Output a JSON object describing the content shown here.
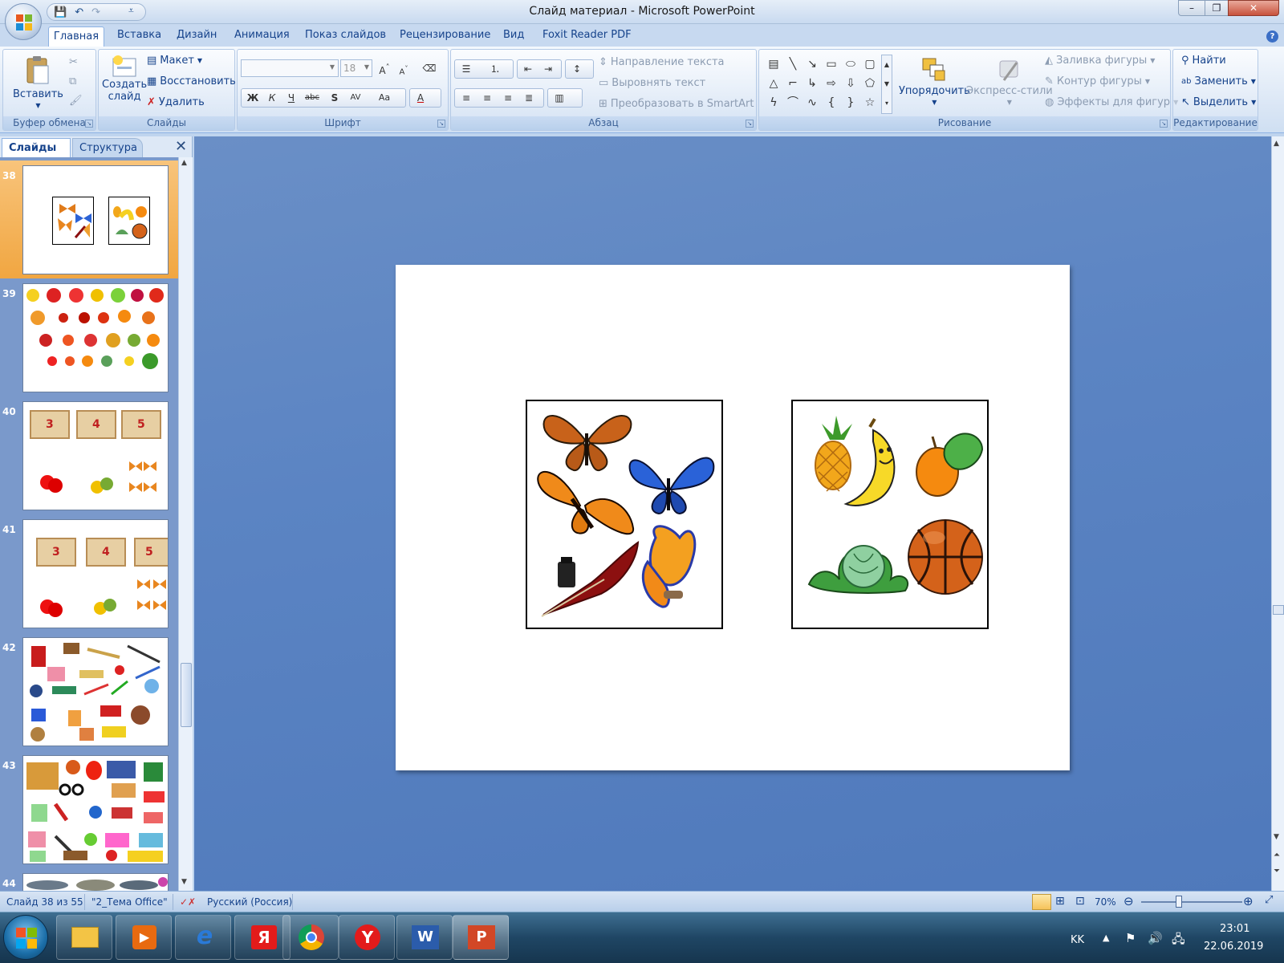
{
  "window": {
    "title": "Слайд материал - Microsoft PowerPoint",
    "minimize": "–",
    "maximize": "❐",
    "close": "✕"
  },
  "ribbon_tabs": [
    "Главная",
    "Вставка",
    "Дизайн",
    "Анимация",
    "Показ слайдов",
    "Рецензирование",
    "Вид",
    "Foxit Reader PDF"
  ],
  "clipboard": {
    "paste": "Вставить",
    "group": "Буфер обмена"
  },
  "slides_group": {
    "new_slide_l1": "Создать",
    "new_slide_l2": "слайд",
    "layout": "Макет",
    "reset": "Восстановить",
    "delete": "Удалить",
    "group": "Слайды"
  },
  "font_group": {
    "size": "18",
    "bold": "Ж",
    "italic": "К",
    "underline": "Ч",
    "strike": "abc",
    "shadow": "S",
    "spacing": "AV",
    "case": "Aa",
    "color": "A",
    "group": "Шрифт"
  },
  "paragraph_group": {
    "text_direction": "Направление текста",
    "align_text": "Выровнять текст",
    "smartart": "Преобразовать в SmartArt",
    "group": "Абзац"
  },
  "drawing_group": {
    "arrange": "Упорядочить",
    "quick_styles": "Экспресс-стили",
    "fill": "Заливка фигуры",
    "outline": "Контур фигуры",
    "effects": "Эффекты для фигур",
    "group": "Рисование"
  },
  "editing_group": {
    "find": "Найти",
    "replace": "Заменить",
    "select": "Выделить",
    "group": "Редактирование"
  },
  "panel": {
    "tab_slides": "Слайды",
    "tab_outline": "Структура",
    "close": "✕"
  },
  "thumbnails": [
    {
      "num": "38",
      "selected": true
    },
    {
      "num": "39",
      "selected": false
    },
    {
      "num": "40",
      "selected": false,
      "labels": [
        "3",
        "4",
        "5"
      ]
    },
    {
      "num": "41",
      "selected": false,
      "labels": [
        "3",
        "4",
        "5"
      ]
    },
    {
      "num": "42",
      "selected": false
    },
    {
      "num": "43",
      "selected": false
    },
    {
      "num": "44",
      "selected": false
    }
  ],
  "status": {
    "slide": "Слайд 38 из 55",
    "theme": "\"2_Тема Office\"",
    "language": "Русский (Россия)",
    "zoom": "70%",
    "zoom_level": 0.7
  },
  "taskbar": {
    "lang": "KK",
    "time": "23:01",
    "date": "22.06.2019"
  },
  "colors": {
    "accent": "#15428b",
    "selected_thumb": "#f4b55a",
    "canvas": "#5b84c3"
  }
}
